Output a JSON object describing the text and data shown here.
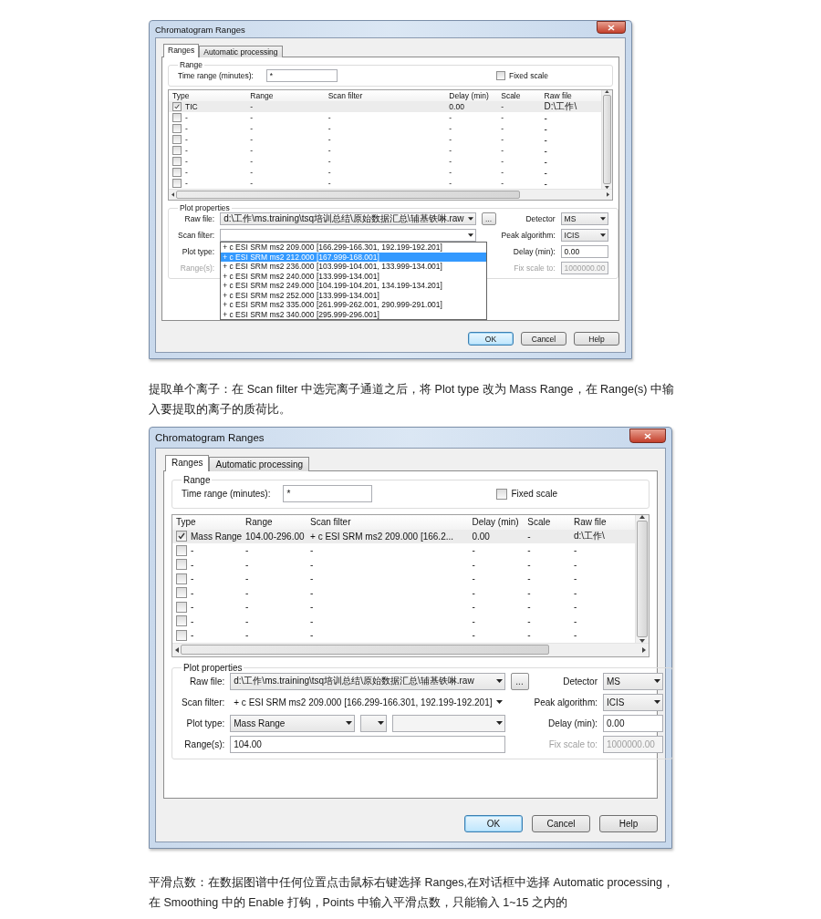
{
  "dialogs": [
    {
      "title": "Chromatogram Ranges",
      "kind": "compact",
      "tabs": [
        {
          "label": "Ranges",
          "selected": true
        },
        {
          "label": "Automatic processing",
          "selected": false
        }
      ],
      "range": {
        "group_label": "Range",
        "time_label": "Time range (minutes):",
        "time_value": "*",
        "fixed_scale": {
          "label": "Fixed scale",
          "checked": false
        }
      },
      "table": {
        "columns": [
          "Type",
          "Range",
          "Scan filter",
          "Delay (min)",
          "Scale",
          "Raw file"
        ],
        "rows": [
          {
            "checked": true,
            "selected": true,
            "type": "TIC",
            "range": "-",
            "delay": "0.00",
            "scale": "-",
            "raw_file": "D:\\工作\\"
          },
          {
            "checked": false,
            "selected": false,
            "type": "-",
            "range": "-",
            "scan_filter": "-",
            "delay": "-",
            "scale": "-",
            "raw_file": "-"
          },
          {
            "checked": false,
            "selected": false,
            "type": "-",
            "range": "-",
            "scan_filter": "-",
            "delay": "-",
            "scale": "-",
            "raw_file": "-"
          },
          {
            "checked": false,
            "selected": false,
            "type": "-",
            "range": "-",
            "scan_filter": "-",
            "delay": "-",
            "scale": "-",
            "raw_file": "-"
          },
          {
            "checked": false,
            "selected": false,
            "type": "-",
            "range": "-",
            "scan_filter": "-",
            "delay": "-",
            "scale": "-",
            "raw_file": "-"
          },
          {
            "checked": false,
            "selected": false,
            "type": "-",
            "range": "-",
            "scan_filter": "-",
            "delay": "-",
            "scale": "-",
            "raw_file": "-"
          },
          {
            "checked": false,
            "selected": false,
            "type": "-",
            "range": "-",
            "scan_filter": "-",
            "delay": "-",
            "scale": "-",
            "raw_file": "-"
          },
          {
            "checked": false,
            "selected": false,
            "type": "-",
            "range": "-",
            "scan_filter": "-",
            "delay": "-",
            "scale": "-",
            "raw_file": "-"
          }
        ]
      },
      "plot": {
        "group_label": "Plot properties",
        "raw_file": {
          "label": "Raw file:",
          "value": "d:\\工作\\ms.training\\tsq培训总结\\原始数据汇总\\辅基铁啉.raw",
          "browse": "..."
        },
        "detector": {
          "label": "Detector",
          "value": "MS"
        },
        "scan_filter": {
          "label": "Scan filter:",
          "expanded": true,
          "options": [
            {
              "text": "+ c ESI SRM ms2 209.000 [166.299-166.301, 192.199-192.201]",
              "selected": false
            },
            {
              "text": "+ c ESI SRM ms2 212.000 [167.999-168.001]",
              "selected": true
            },
            {
              "text": "+ c ESI SRM ms2 236.000 [103.999-104.001, 133.999-134.001]",
              "selected": false
            },
            {
              "text": "+ c ESI SRM ms2 240.000 [133.999-134.001]",
              "selected": false
            },
            {
              "text": "+ c ESI SRM ms2 249.000 [104.199-104.201, 134.199-134.201]",
              "selected": false
            },
            {
              "text": "+ c ESI SRM ms2 252.000 [133.999-134.001]",
              "selected": false
            },
            {
              "text": "+ c ESI SRM ms2 335.000 [261.999-262.001, 290.999-291.001]",
              "selected": false
            },
            {
              "text": "+ c ESI SRM ms2 340.000 [295.999-296.001]",
              "selected": false
            }
          ]
        },
        "peak_algorithm": {
          "label": "Peak algorithm:",
          "value": "ICIS"
        },
        "plot_type": {
          "label": "Plot type:"
        },
        "delay": {
          "label": "Delay (min):",
          "value": "0.00"
        },
        "ranges": {
          "label": "Range(s):",
          "disabled": true
        },
        "fix_scale": {
          "label": "Fix scale to:",
          "value": "1000000.00",
          "disabled": true
        }
      },
      "buttons": [
        {
          "label": "OK",
          "default": true
        },
        {
          "label": "Cancel",
          "default": false
        },
        {
          "label": "Help",
          "default": false
        }
      ]
    },
    {
      "title": "Chromatogram Ranges",
      "kind": "full",
      "tabs": [
        {
          "label": "Ranges",
          "selected": true
        },
        {
          "label": "Automatic processing",
          "selected": false
        }
      ],
      "range": {
        "group_label": "Range",
        "time_label": "Time range (minutes):",
        "time_value": "*",
        "fixed_scale": {
          "label": "Fixed scale",
          "checked": false
        }
      },
      "table": {
        "columns": [
          "Type",
          "Range",
          "Scan filter",
          "Delay (min)",
          "Scale",
          "Raw file"
        ],
        "rows": [
          {
            "checked": true,
            "selected": true,
            "type": "Mass Range",
            "range": "104.00-296.00",
            "scan_filter": "+ c ESI SRM ms2 209.000 [166.2...",
            "delay": "0.00",
            "scale": "-",
            "raw_file": "d:\\工作\\"
          },
          {
            "checked": false,
            "selected": false,
            "type": "-",
            "range": "-",
            "scan_filter": "-",
            "delay": "-",
            "scale": "-",
            "raw_file": "-"
          },
          {
            "checked": false,
            "selected": false,
            "type": "-",
            "range": "-",
            "scan_filter": "-",
            "delay": "-",
            "scale": "-",
            "raw_file": "-"
          },
          {
            "checked": false,
            "selected": false,
            "type": "-",
            "range": "-",
            "scan_filter": "-",
            "delay": "-",
            "scale": "-",
            "raw_file": "-"
          },
          {
            "checked": false,
            "selected": false,
            "type": "-",
            "range": "-",
            "scan_filter": "-",
            "delay": "-",
            "scale": "-",
            "raw_file": "-"
          },
          {
            "checked": false,
            "selected": false,
            "type": "-",
            "range": "-",
            "scan_filter": "-",
            "delay": "-",
            "scale": "-",
            "raw_file": "-"
          },
          {
            "checked": false,
            "selected": false,
            "type": "-",
            "range": "-",
            "scan_filter": "-",
            "delay": "-",
            "scale": "-",
            "raw_file": "-"
          },
          {
            "checked": false,
            "selected": false,
            "type": "-",
            "range": "-",
            "scan_filter": "-",
            "delay": "-",
            "scale": "-",
            "raw_file": "-"
          }
        ]
      },
      "plot": {
        "group_label": "Plot properties",
        "raw_file": {
          "label": "Raw file:",
          "value": "d:\\工作\\ms.training\\tsq培训总结\\原始数据汇总\\辅基铁啉.raw",
          "browse": "..."
        },
        "detector": {
          "label": "Detector",
          "value": "MS"
        },
        "scan_filter": {
          "label": "Scan filter:",
          "value": "+ c ESI SRM ms2 209.000 [166.299-166.301, 192.199-192.201]",
          "expanded": false
        },
        "peak_algorithm": {
          "label": "Peak algorithm:",
          "value": "ICIS"
        },
        "plot_type": {
          "label": "Plot type:",
          "value": "Mass Range"
        },
        "delay": {
          "label": "Delay (min):",
          "value": "0.00"
        },
        "ranges": {
          "label": "Range(s):",
          "value": "104.00",
          "disabled": false
        },
        "fix_scale": {
          "label": "Fix scale to:",
          "value": "1000000.00",
          "disabled": true
        }
      },
      "buttons": [
        {
          "label": "OK",
          "default": true
        },
        {
          "label": "Cancel",
          "default": false
        },
        {
          "label": "Help",
          "default": false
        }
      ]
    }
  ],
  "paragraphs": [
    "提取单个离子：在 Scan filter 中选完离子通道之后，将 Plot type 改为 Mass Range，在 Range(s) 中输入要提取的离子的质荷比。",
    "平滑点数：在数据图谱中任何位置点击鼠标右键选择 Ranges,在对话框中选择 Automatic processing，在 Smoothing 中的 Enable 打钩，Points 中输入平滑点数，只能输入 1~15 之内的"
  ]
}
